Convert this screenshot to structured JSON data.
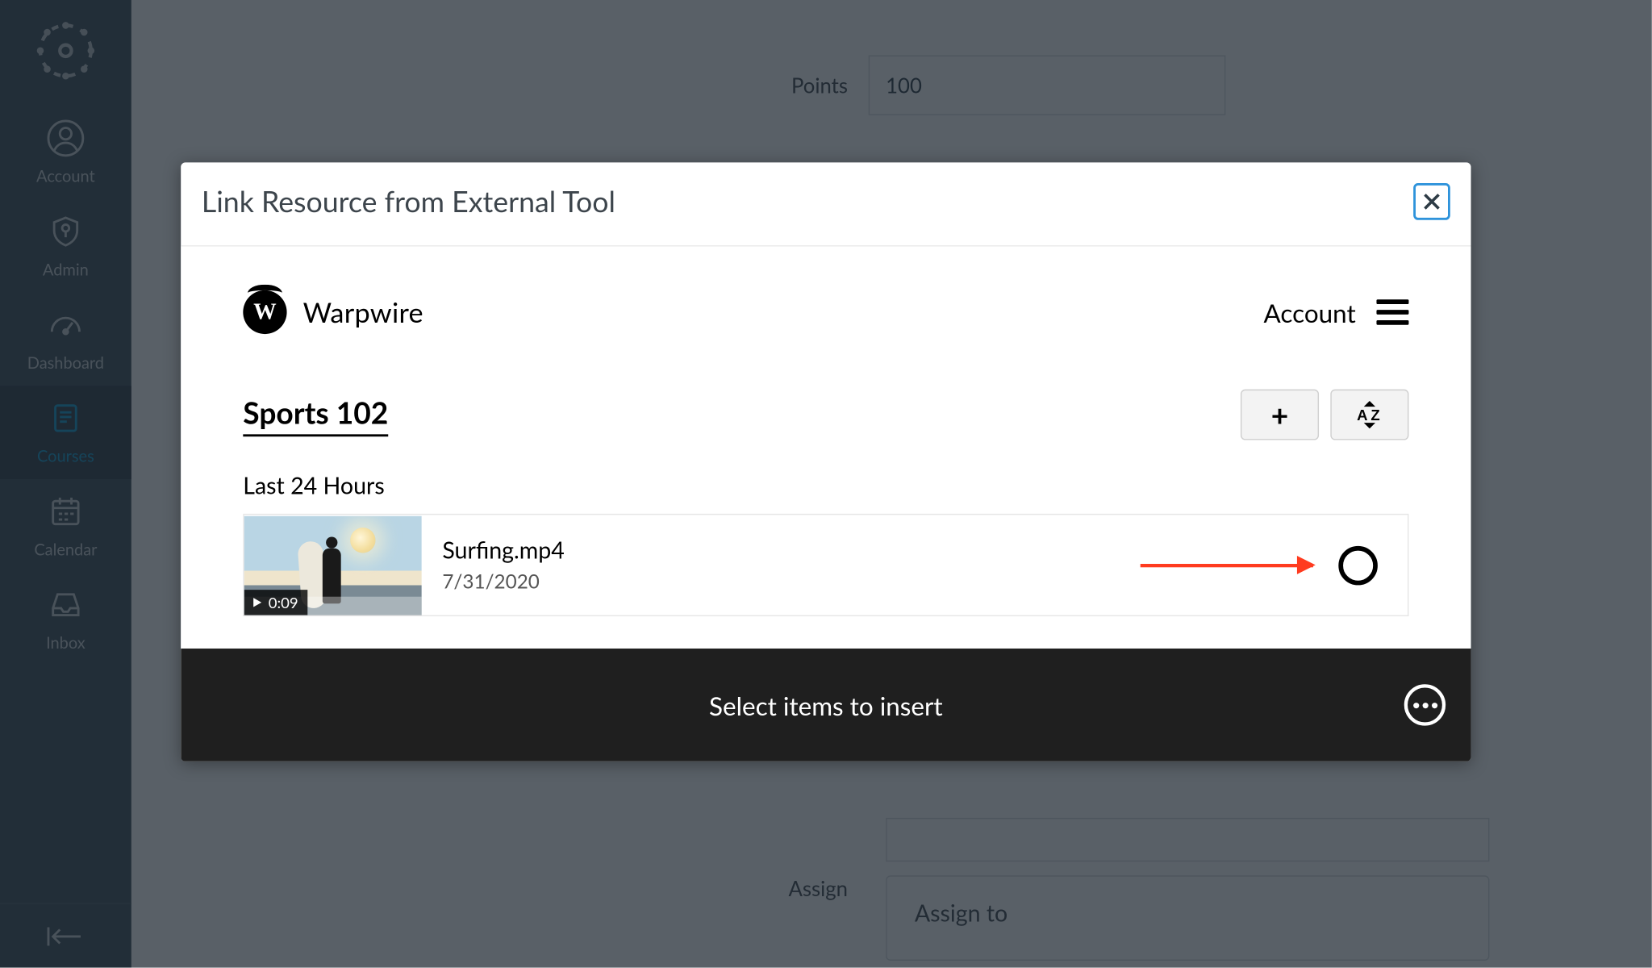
{
  "nav": {
    "items": [
      {
        "label": "Account"
      },
      {
        "label": "Admin"
      },
      {
        "label": "Dashboard"
      },
      {
        "label": "Courses"
      },
      {
        "label": "Calendar"
      },
      {
        "label": "Inbox"
      }
    ]
  },
  "form": {
    "points_label": "Points",
    "points_value": "100",
    "assign_label": "Assign",
    "assign_to_label": "Assign to"
  },
  "dialog": {
    "title": "Link Resource from External Tool",
    "warpwire": {
      "brand": "Warpwire",
      "account_label": "Account",
      "course_title": "Sports 102",
      "section_label": "Last 24 Hours",
      "items": [
        {
          "name": "Surfing.mp4",
          "date": "7/31/2020",
          "duration": "0:09"
        }
      ],
      "footer_text": "Select items to insert"
    }
  }
}
